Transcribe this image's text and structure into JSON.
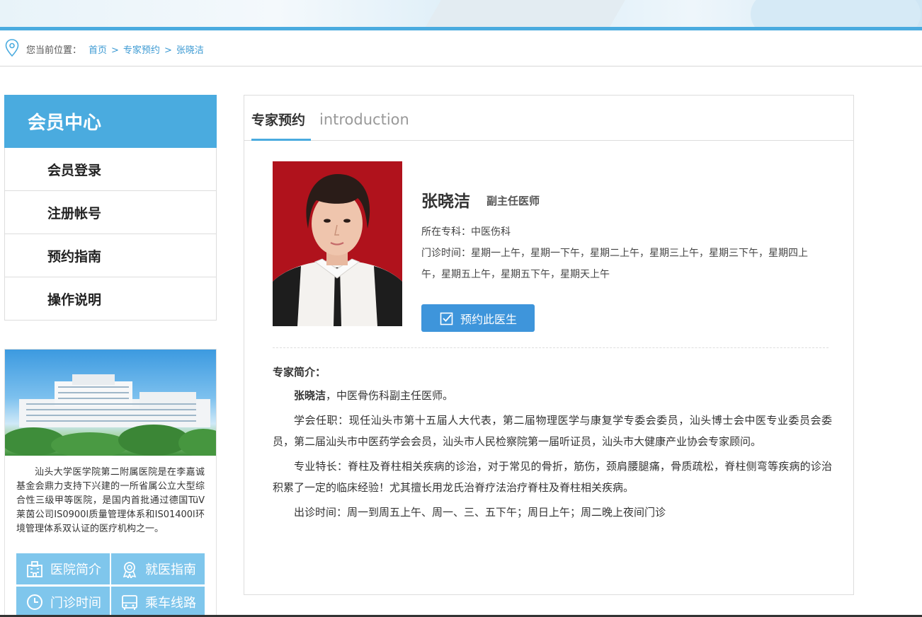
{
  "breadcrumb": {
    "label": "您当前位置：",
    "items": [
      "首页",
      "专家预约",
      "张晓洁"
    ],
    "separator": ">"
  },
  "sidebar": {
    "title": "会员中心",
    "items": [
      "会员登录",
      "注册帐号",
      "预约指南",
      "操作说明"
    ]
  },
  "hospital": {
    "description": "汕头大学医学院第二附属医院是在李嘉诚基金会鼎力支持下兴建的一所省属公立大型综合性三级甲等医院，是国内首批通过德国TüV莱茵公司IS0900l质量管理体系和IS01400l环境管理体系双认证的医疗机构之一。",
    "quick_links": [
      {
        "label": "医院简介",
        "icon": "hospital-icon"
      },
      {
        "label": "就医指南",
        "icon": "badge-icon"
      },
      {
        "label": "门诊时间",
        "icon": "clock-icon"
      },
      {
        "label": "乘车线路",
        "icon": "bus-icon"
      }
    ]
  },
  "panel": {
    "title": "专家预约",
    "subtitle": "introduction"
  },
  "doctor": {
    "name": "张晓洁",
    "title": "副主任医师",
    "dept_label": "所在专科：",
    "dept": "中医伤科",
    "clinic_label": "门诊时间：",
    "clinic_times": "星期一上午，星期一下午，星期二上午，星期三上午，星期三下午，星期四上午，星期五上午，星期五下午，星期天上午",
    "book_label": "预约此医生"
  },
  "intro": {
    "heading": "专家简介：",
    "lead_name": "张晓洁",
    "lead_rest": "，中医骨伤科副主任医师。",
    "p1": "学会任职：现任汕头市第十五届人大代表，第二届物理医学与康复学专委会委员，汕头博士会中医专业委员会委员，第二届汕头市中医药学会会员，汕头市人民检察院第一届听证员，汕头市大健康产业协会专家顾问。",
    "p2": "专业特长：脊柱及脊柱相关疾病的诊治，对于常见的骨折，筋伤，颈肩腰腿痛，骨质疏松，脊柱侧弯等疾病的诊治积累了一定的临床经验！尤其擅长用龙氏治脊疗法治疗脊柱及脊柱相关疾病。",
    "p3": "出诊时间：周一到周五上午、周一、三、五下午；周日上午；周二晚上夜间门诊"
  },
  "colors": {
    "accent": "#4aabdf",
    "button": "#3e95db",
    "quick_link": "#7fc6ec",
    "photo_bg": "#b0121c"
  }
}
